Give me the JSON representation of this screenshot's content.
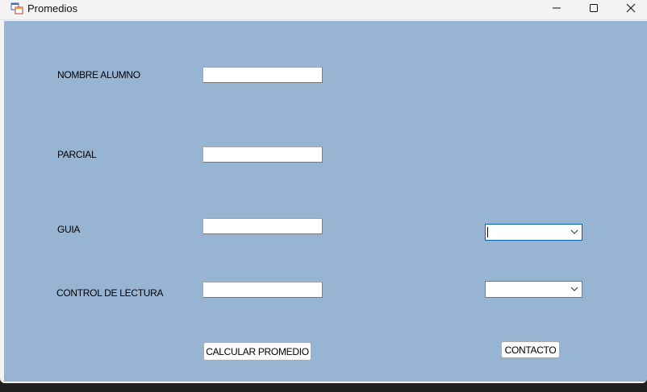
{
  "window": {
    "title": "Promedios",
    "app_icon": "winforms-app-icon",
    "controls": {
      "minimize_icon": "minimize-icon",
      "maximize_icon": "maximize-icon",
      "close_icon": "close-icon"
    }
  },
  "form": {
    "background_color": "#98b4d3",
    "labels": {
      "nombre_alumno": "NOMBRE ALUMNO",
      "parcial": "PARCIAL",
      "guia": "GUIA",
      "control_lectura": "CONTROL DE LECTURA"
    },
    "inputs": {
      "nombre_alumno": "",
      "parcial": "",
      "guia": "",
      "control_lectura": ""
    },
    "combos": {
      "guia_selected": "",
      "control_lectura_selected": ""
    },
    "buttons": {
      "calcular": "CALCULAR PROMEDIO",
      "contacto": "CONTACTO"
    }
  }
}
